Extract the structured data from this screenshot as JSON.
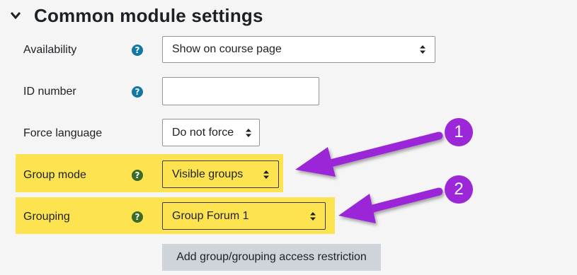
{
  "section": {
    "title": "Common module settings",
    "collapse_icon": "chevron-down-icon"
  },
  "fields": {
    "availability": {
      "label": "Availability",
      "value": "Show on course page",
      "help_icon": "help-icon"
    },
    "id_number": {
      "label": "ID number",
      "value": "",
      "help_icon": "help-icon"
    },
    "force_language": {
      "label": "Force language",
      "value": "Do not force"
    },
    "group_mode": {
      "label": "Group mode",
      "value": "Visible groups",
      "help_icon": "help-icon"
    },
    "grouping": {
      "label": "Grouping",
      "value": "Group Forum 1",
      "help_icon": "help-icon"
    }
  },
  "buttons": {
    "add_restriction": "Add group/grouping access restriction"
  },
  "annotations": [
    {
      "number": "1",
      "points_to": "group_mode"
    },
    {
      "number": "2",
      "points_to": "grouping"
    }
  ],
  "colors": {
    "highlight": "#fde350",
    "annotation": "#9b27d8",
    "help_teal": "#1177a3",
    "help_olive": "#3b6b27",
    "button_bg": "#ced4da"
  }
}
